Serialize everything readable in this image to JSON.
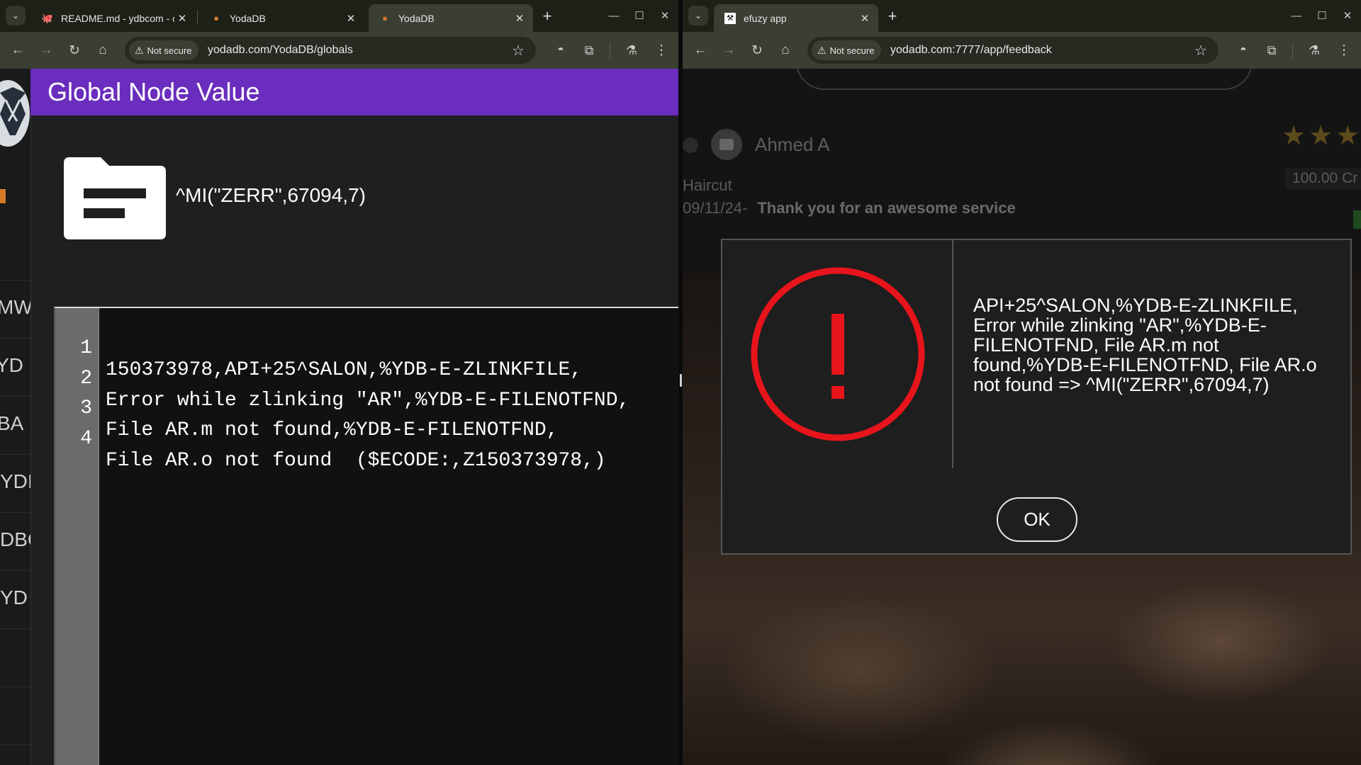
{
  "left_window": {
    "tabs": [
      {
        "title": "README.md - ydbcom - co",
        "icon": "github-icon"
      },
      {
        "title": "YodaDB",
        "icon": "yodadb-icon"
      },
      {
        "title": "YodaDB",
        "icon": "yodadb-icon",
        "active": true
      }
    ],
    "address": {
      "security_label": "Not secure",
      "url": "yodadb.com/YodaDB/globals"
    },
    "rail_items": [
      "MW",
      "YD",
      "BA",
      "YDI",
      "DBC",
      "YD"
    ],
    "header_title": "Global Node Value",
    "node_key": "^MI(\"ZERR\",67094,7)",
    "code_lines": [
      {
        "num": "1",
        "text": "150373978,API+25^SALON,%YDB-E-ZLINKFILE,"
      },
      {
        "num": "2",
        "text": "Error while zlinking \"AR\",%YDB-E-FILENOTFND,"
      },
      {
        "num": "3",
        "text": "File AR.m not found,%YDB-E-FILENOTFND,"
      },
      {
        "num": "4",
        "text": "File AR.o not found  ($ECODE:,Z150373978,)"
      }
    ]
  },
  "right_window": {
    "tabs": [
      {
        "title": "efuzy app",
        "icon": "efuzy-icon",
        "active": true
      }
    ],
    "address": {
      "security_label": "Not secure",
      "url": "yodadb.com:7777/app/feedback"
    },
    "reviewer_name": "Ahmed A",
    "service": "Haircut",
    "price": "100.00 Cr",
    "review_date": "09/11/24-",
    "review_text": "Thank you for an awesome service",
    "rating_stars": "★★★",
    "dialog": {
      "message": "API+25^SALON,%YDB-E-ZLINKFILE, Error while zlinking \"AR\",%YDB-E-FILENOTFND, File AR.m not found,%YDB-E-FILENOTFND, File AR.o not found => ^MI(\"ZERR\",67094,7)",
      "ok_label": "OK",
      "icon": "error-exclamation-icon",
      "accent_color": "#e8141b"
    }
  },
  "colors": {
    "header_purple": "#6a2dbd",
    "toolbar": "#3a3e33",
    "tabbar": "#1d2016"
  }
}
